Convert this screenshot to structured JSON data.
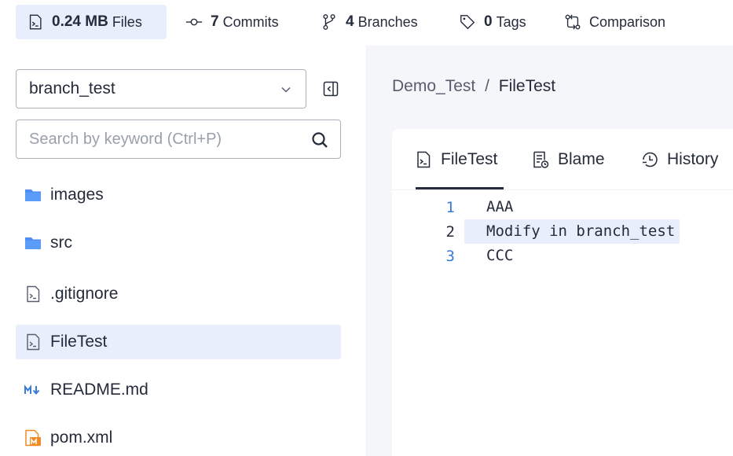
{
  "stats": {
    "files": {
      "value": "0.24 MB",
      "label": "Files"
    },
    "commits": {
      "value": "7",
      "label": "Commits"
    },
    "branches": {
      "value": "4",
      "label": "Branches"
    },
    "tags": {
      "value": "0",
      "label": "Tags"
    },
    "comparison": {
      "label": "Comparison"
    }
  },
  "sidebar": {
    "branch": "branch_test",
    "search_placeholder": "Search by keyword (Ctrl+P)",
    "items": [
      {
        "label": "images",
        "icon": "folder-icon"
      },
      {
        "label": "src",
        "icon": "folder-icon"
      },
      {
        "label": ".gitignore",
        "icon": "file-icon"
      },
      {
        "label": "FileTest",
        "icon": "file-icon",
        "selected": true
      },
      {
        "label": "README.md",
        "icon": "markdown-icon"
      },
      {
        "label": "pom.xml",
        "icon": "maven-icon"
      }
    ]
  },
  "breadcrumb": {
    "repo": "Demo_Test",
    "separator": "/",
    "file": "FileTest"
  },
  "tabs": [
    {
      "label": "FileTest",
      "icon": "file-icon"
    },
    {
      "label": "Blame",
      "icon": "blame-icon"
    },
    {
      "label": "History",
      "icon": "history-icon"
    }
  ],
  "code": [
    {
      "line": "1",
      "text": "AAA"
    },
    {
      "line": "2",
      "text": "Modify in branch_test"
    },
    {
      "line": "3",
      "text": "CCC"
    }
  ],
  "colors": {
    "accent": "#3a7bd5",
    "selected_bg": "#e8eefb",
    "folder": "#4f8ef7"
  }
}
